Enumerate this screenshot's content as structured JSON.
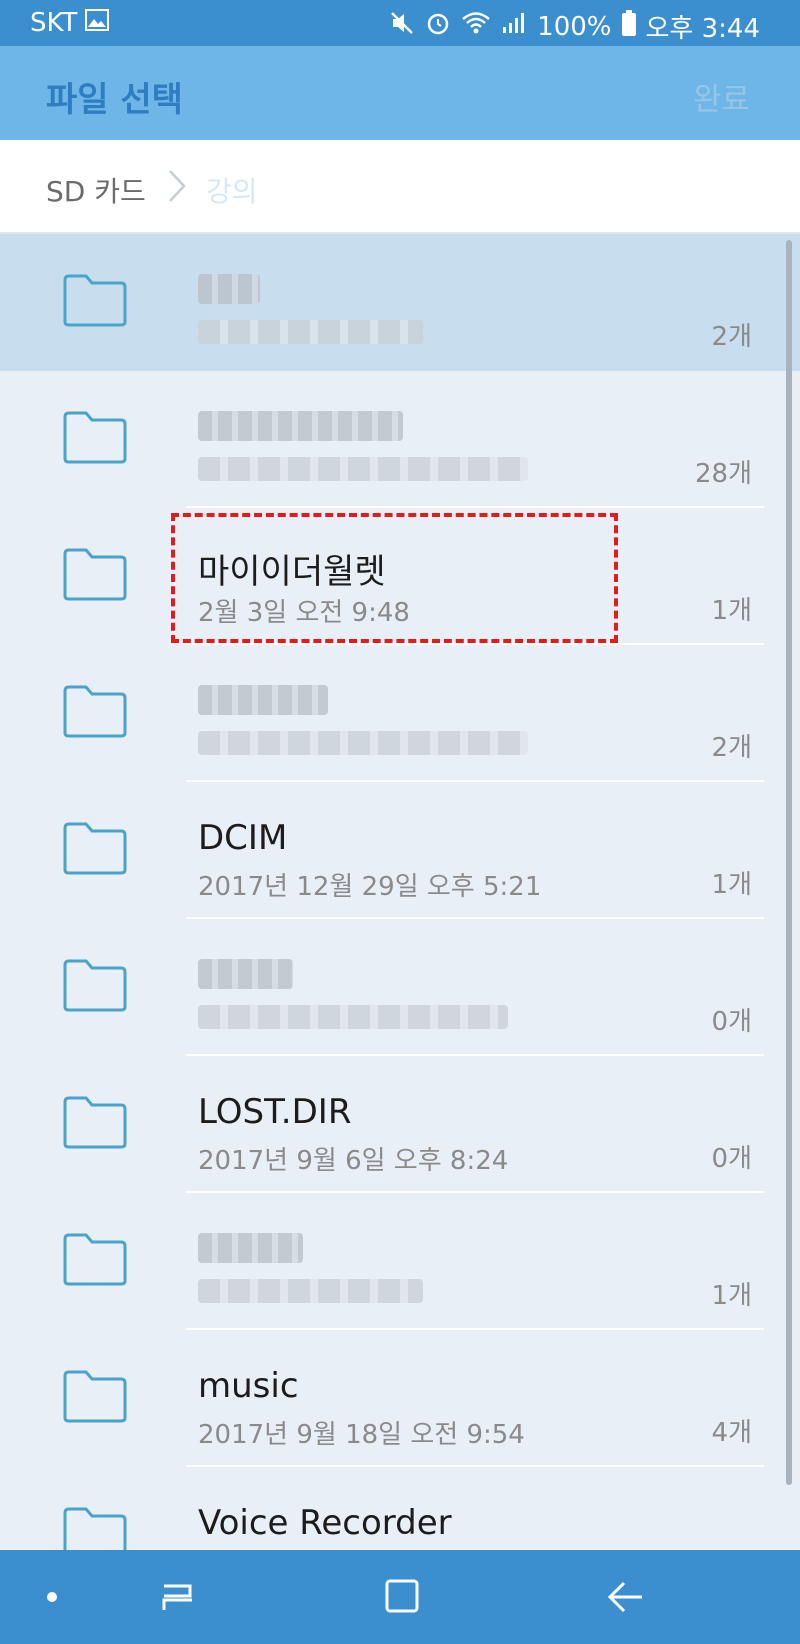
{
  "status_bar": {
    "carrier": "SKT",
    "battery": "100%",
    "time": "오후 3:44"
  },
  "app_bar": {
    "title": "파일 선택",
    "done_label": "완료"
  },
  "breadcrumb": {
    "root": "SD 카드",
    "current": "강의"
  },
  "files": [
    {
      "name": "",
      "date": "",
      "count": "2개",
      "blurred": true,
      "selected": true
    },
    {
      "name": "",
      "date": "",
      "count": "28개",
      "blurred": true
    },
    {
      "name": "마이이더월렛",
      "date": "2월 3일 오전 9:48",
      "count": "1개",
      "highlighted": true
    },
    {
      "name": "",
      "date": "",
      "count": "2개",
      "blurred": true
    },
    {
      "name": "DCIM",
      "date": "2017년 12월 29일 오후 5:21",
      "count": "1개"
    },
    {
      "name": "",
      "date": "",
      "count": "0개",
      "blurred": true
    },
    {
      "name": "LOST.DIR",
      "date": "2017년 9월 6일 오후 8:24",
      "count": "0개"
    },
    {
      "name": "",
      "date": "",
      "count": "1개",
      "blurred": true
    },
    {
      "name": "music",
      "date": "2017년 9월 18일 오전 9:54",
      "count": "4개"
    },
    {
      "name": "Voice Recorder",
      "date": "",
      "count": ""
    }
  ],
  "colors": {
    "status_bar": "#3c8fcf",
    "app_bar": "#6eb6e8",
    "folder_icon": "#4aa3c9",
    "highlight": "#e21b1b"
  },
  "icons": {
    "navigation": [
      "dot-icon",
      "recent-apps-icon",
      "home-icon",
      "back-icon"
    ]
  }
}
